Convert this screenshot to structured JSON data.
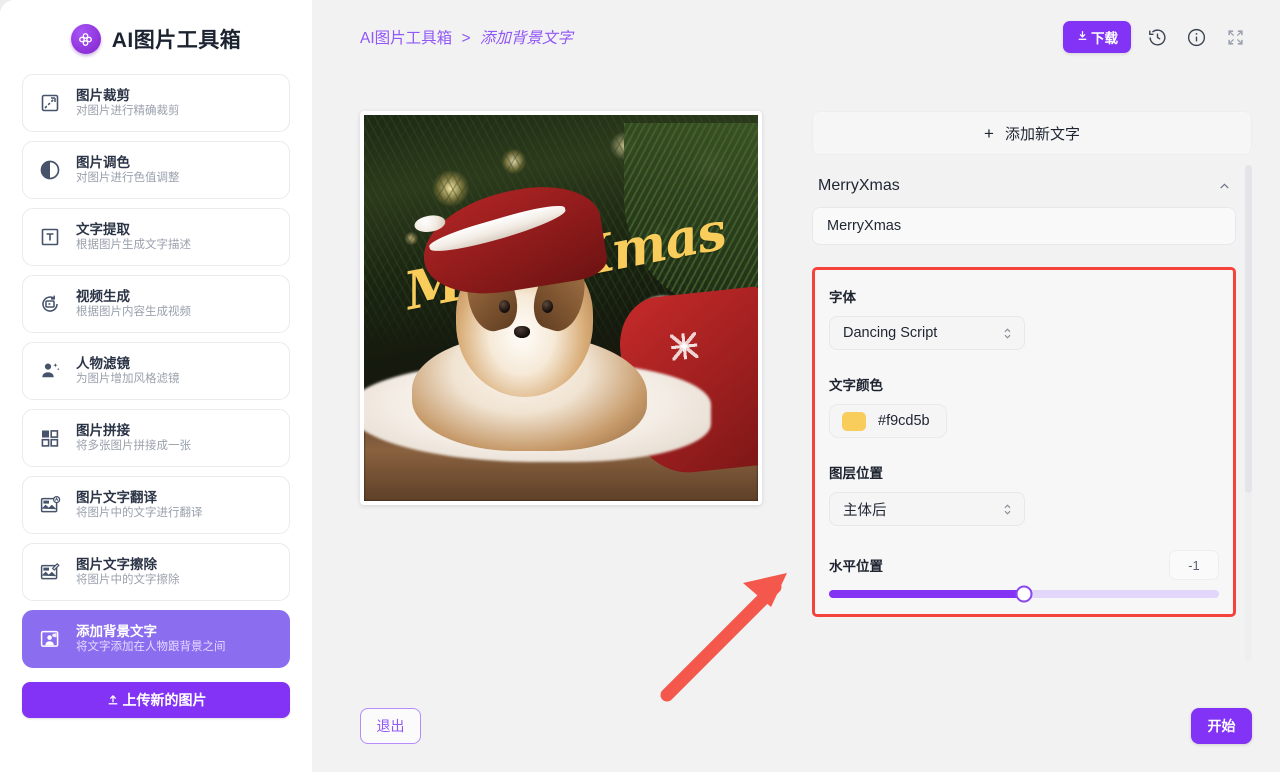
{
  "brand": {
    "title": "AI图片工具箱",
    "logo_icon": "clover-logo-icon",
    "accent": "#8233f5"
  },
  "sidebar": {
    "items": [
      {
        "name": "图片裁剪",
        "desc": "对图片进行精确裁剪",
        "icon": "crop-icon",
        "active": false
      },
      {
        "name": "图片调色",
        "desc": "对图片进行色值调整",
        "icon": "contrast-icon",
        "active": false
      },
      {
        "name": "文字提取",
        "desc": "根据图片生成文字描述",
        "icon": "text-box-icon",
        "active": false
      },
      {
        "name": "视频生成",
        "desc": "根据图片内容生成视频",
        "icon": "video-refresh-icon",
        "active": false
      },
      {
        "name": "人物滤镜",
        "desc": "为图片增加风格滤镜",
        "icon": "person-sparkle-icon",
        "active": false
      },
      {
        "name": "图片拼接",
        "desc": "将多张图片拼接成一张",
        "icon": "grid-tiles-icon",
        "active": false
      },
      {
        "name": "图片文字翻译",
        "desc": "将图片中的文字进行翻译",
        "icon": "image-translate-icon",
        "active": false
      },
      {
        "name": "图片文字擦除",
        "desc": "将图片中的文字擦除",
        "icon": "image-erase-text-icon",
        "active": false
      },
      {
        "name": "添加背景文字",
        "desc": "将文字添加在人物跟背景之间",
        "icon": "image-bg-text-icon",
        "active": true
      }
    ],
    "upload_label": "上传新的图片",
    "upload_icon": "upload-icon"
  },
  "topbar": {
    "breadcrumb_root": "AI图片工具箱",
    "breadcrumb_sep": ">",
    "breadcrumb_current": "添加背景文字",
    "download_label": "下载",
    "download_icon": "download-icon",
    "history_icon": "history-clock-icon",
    "info_icon": "info-circle-icon",
    "fullscreen_icon": "fullscreen-expand-icon"
  },
  "preview": {
    "overlay_text": "MerryXmas",
    "overlay_color": "#f9cd5b",
    "scene_alt": "圣诞树下戴圣诞帽的小狗"
  },
  "panel": {
    "add_text_label": "添加新文字",
    "add_text_icon": "plus-icon",
    "layer": {
      "title": "MerryXmas",
      "collapse_icon": "chevron-up-icon",
      "text_value": "MerryXmas",
      "text_placeholder": "MerryXmas"
    },
    "font": {
      "label": "字体",
      "value": "Dancing Script",
      "stepper_icon": "stepper-updown-icon"
    },
    "text_color": {
      "label": "文字颜色",
      "hex": "#f9cd5b"
    },
    "layer_position": {
      "label": "图层位置",
      "value": "主体后",
      "stepper_icon": "stepper-updown-icon"
    },
    "horizontal_position": {
      "label": "水平位置",
      "value": "-1",
      "percent": 50
    },
    "highlight_border_color": "#f4433a"
  },
  "footer": {
    "exit_label": "退出",
    "start_label": "开始"
  },
  "annotation": {
    "arrow_color": "#f4574b",
    "arrow_icon": "red-pointer-arrow-icon"
  }
}
